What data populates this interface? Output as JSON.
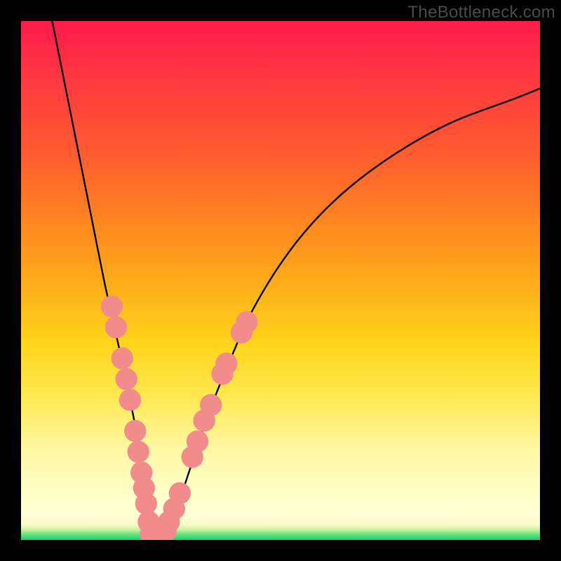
{
  "watermark": {
    "text": "TheBottleneck.com"
  },
  "chart_data": {
    "type": "line",
    "title": "",
    "xlabel": "",
    "ylabel": "",
    "xlim": [
      0,
      100
    ],
    "ylim": [
      0,
      100
    ],
    "grid": false,
    "legend": false,
    "series": [
      {
        "name": "curve",
        "x": [
          6,
          8,
          10,
          12,
          14,
          16,
          18,
          20,
          22,
          23,
          24,
          25,
          26,
          27,
          28,
          30,
          32,
          34,
          36,
          40,
          45,
          52,
          60,
          70,
          82,
          95,
          100
        ],
        "y": [
          100,
          90,
          80,
          70,
          60,
          50,
          41,
          32,
          22,
          16,
          10,
          4,
          0,
          0,
          2,
          6,
          12,
          18,
          24,
          34,
          45,
          56,
          65,
          73,
          80,
          85,
          87
        ]
      }
    ],
    "beads": [
      {
        "x": 17.5,
        "y": 45,
        "r": 1.6
      },
      {
        "x": 18.3,
        "y": 41,
        "r": 1.6
      },
      {
        "x": 19.5,
        "y": 35,
        "r": 1.6
      },
      {
        "x": 20.3,
        "y": 31,
        "r": 1.6
      },
      {
        "x": 21.0,
        "y": 27,
        "r": 1.6
      },
      {
        "x": 22.0,
        "y": 21,
        "r": 1.6
      },
      {
        "x": 22.6,
        "y": 17,
        "r": 1.6
      },
      {
        "x": 23.2,
        "y": 13,
        "r": 1.6
      },
      {
        "x": 23.7,
        "y": 10,
        "r": 1.6
      },
      {
        "x": 24.1,
        "y": 7,
        "r": 1.6
      },
      {
        "x": 24.6,
        "y": 3.5,
        "r": 1.6
      },
      {
        "x": 25.1,
        "y": 1.2,
        "r": 1.7
      },
      {
        "x": 25.8,
        "y": 0.2,
        "r": 1.7
      },
      {
        "x": 26.5,
        "y": 0.2,
        "r": 1.7
      },
      {
        "x": 27.2,
        "y": 0.6,
        "r": 1.7
      },
      {
        "x": 27.8,
        "y": 1.8,
        "r": 1.7
      },
      {
        "x": 28.5,
        "y": 3.5,
        "r": 1.6
      },
      {
        "x": 29.5,
        "y": 6,
        "r": 1.6
      },
      {
        "x": 30.6,
        "y": 9,
        "r": 1.6
      },
      {
        "x": 33.0,
        "y": 16,
        "r": 1.6
      },
      {
        "x": 34.0,
        "y": 19,
        "r": 1.6
      },
      {
        "x": 35.3,
        "y": 23,
        "r": 1.6
      },
      {
        "x": 36.6,
        "y": 26,
        "r": 1.6
      },
      {
        "x": 38.8,
        "y": 32,
        "r": 1.6
      },
      {
        "x": 39.6,
        "y": 34,
        "r": 1.6
      },
      {
        "x": 42.5,
        "y": 40,
        "r": 1.6
      },
      {
        "x": 43.5,
        "y": 42,
        "r": 1.6
      }
    ],
    "gradient_stops": [
      {
        "pos": 0,
        "color": "#ff1a4b"
      },
      {
        "pos": 25,
        "color": "#ff5a30"
      },
      {
        "pos": 52,
        "color": "#ffb219"
      },
      {
        "pos": 82,
        "color": "#fff7a0"
      },
      {
        "pos": 99,
        "color": "#5fe07b"
      },
      {
        "pos": 100,
        "color": "#0bd66c"
      }
    ]
  }
}
